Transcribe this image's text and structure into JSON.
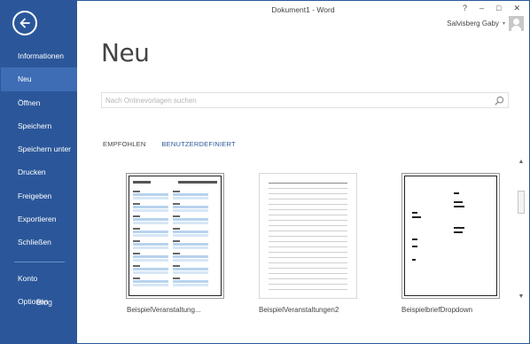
{
  "window": {
    "title": "Dokument1 - Word",
    "help": "?",
    "minimize": "–",
    "maximize": "□",
    "close": "✕"
  },
  "user": {
    "name": "Salvisberg Gaby",
    "caret": "▾"
  },
  "sidebar": {
    "back_icon": "arrow-left-icon",
    "items": [
      {
        "label": "Informationen"
      },
      {
        "label": "Neu",
        "active": true
      },
      {
        "label": "Öffnen"
      },
      {
        "label": "Speichern"
      },
      {
        "label": "Speichern unter"
      },
      {
        "label": "Drucken"
      },
      {
        "label": "Freigeben"
      },
      {
        "label": "Exportieren"
      },
      {
        "label": "Schließen"
      }
    ],
    "bottom_items": [
      {
        "label": "Konto"
      },
      {
        "label": "Optionen"
      }
    ],
    "overlap_text": "Blog"
  },
  "main": {
    "title": "Neu",
    "search": {
      "placeholder": "Nach Onlinevorlagen suchen",
      "icon": "search-icon"
    },
    "tabs": [
      {
        "label": "EMPFOHLEN"
      },
      {
        "label": "BENUTZERDEFINIERT"
      }
    ],
    "templates": [
      {
        "label": "BeispielVeranstaltung...",
        "selected": true
      },
      {
        "label": "BeispielVeranstaltungen2"
      },
      {
        "label": "BeispielbriefDropdown"
      }
    ]
  },
  "scrollbar": {
    "up": "▲",
    "down": "▼"
  },
  "colors": {
    "accent": "#2b579a",
    "accent_active": "#3e6db5"
  }
}
